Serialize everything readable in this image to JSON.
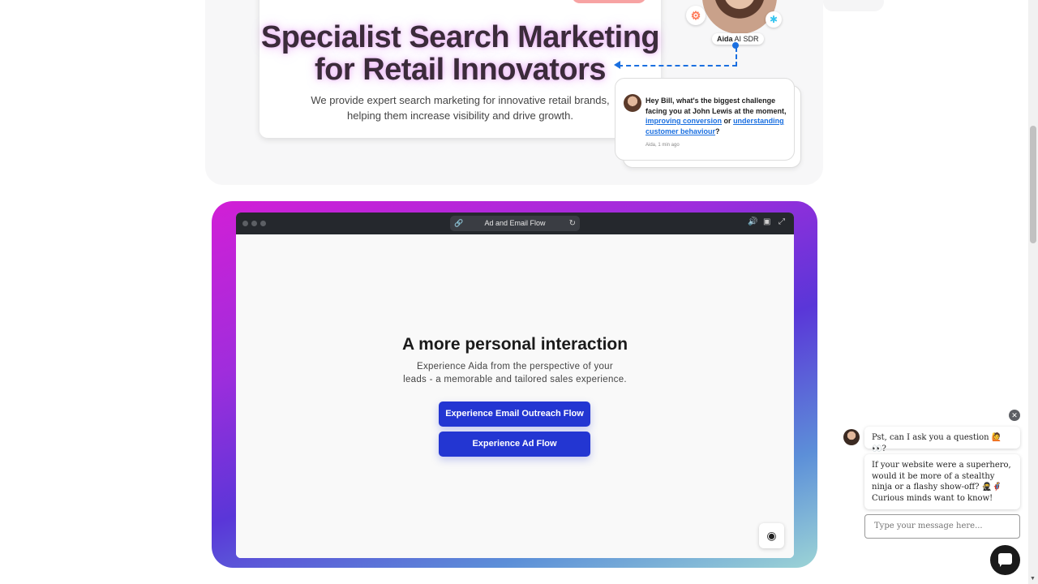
{
  "hero": {
    "title_line1": "Specialist Search Marketing",
    "title_line2": "for Retail Innovators",
    "subtitle_line1": "We provide expert search marketing for innovative retail brands,",
    "subtitle_line2": "helping them increase visibility and drive growth."
  },
  "aida": {
    "name": "Aida",
    "role": "AI SDR",
    "message_part1": "Hey Bill, what's the biggest challenge facing you at John Lewis at the moment,",
    "link1": "improving conversion",
    "or_text": "or",
    "link2": "understanding customer behaviour",
    "end_text": "?",
    "meta": "Aida, 1 min ago"
  },
  "demo": {
    "url_title": "Ad and Email Flow",
    "heading": "A more personal interaction",
    "sub_line1": "Experience Aida from the perspective of your",
    "sub_line2": "leads - a memorable and tailored sales experience.",
    "button_email": "Experience Email Outreach Flow",
    "button_ad": "Experience Ad Flow"
  },
  "chat_widget": {
    "bubble1": "Pst, can I ask you a question 🙋 👀?",
    "bubble2": "If your website were a superhero, would it be more of a stealthy ninja or a flashy show-off? 🥷🦸 Curious minds want to know!",
    "input_placeholder": "Type your message here...",
    "close_glyph": "✕"
  },
  "icons": {
    "hubspot": "hubspot-icon",
    "link": "link-icon",
    "reload": "reload-icon",
    "volume": "volume-icon",
    "captions": "captions-icon",
    "fullscreen": "fullscreen-icon"
  },
  "colors": {
    "accent_blue": "#2336d2",
    "link_blue": "#1a6fe0",
    "frame_pink": "#d21fd6",
    "frame_indigo": "#5a36d8"
  }
}
